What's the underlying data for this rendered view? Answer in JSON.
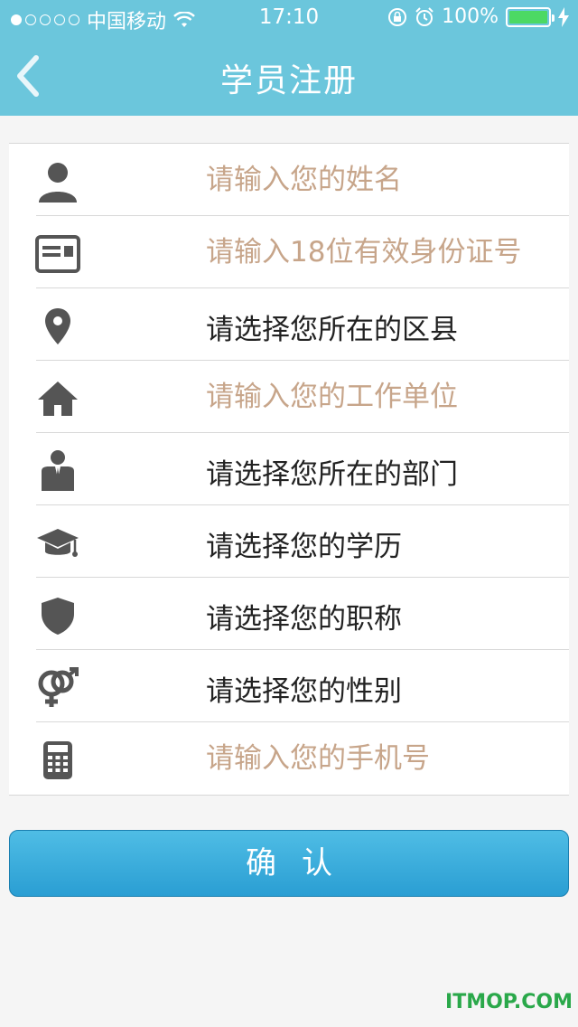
{
  "status_bar": {
    "carrier": "中国移动",
    "time": "17:10",
    "battery": "100%",
    "signal_dots_filled": 1
  },
  "nav": {
    "title": "学员注册",
    "back_icon": "chevron-left-icon"
  },
  "form": {
    "name_placeholder": "请输入您的姓名",
    "id_placeholder": "请输入18位有效身份证号",
    "district_label": "请选择您所在的区县",
    "workplace_placeholder": "请输入您的工作单位",
    "department_label": "请选择您所在的部门",
    "education_label": "请选择您的学历",
    "title_label": "请选择您的职称",
    "gender_label": "请选择您的性别",
    "phone_placeholder": "请输入您的手机号"
  },
  "confirm_label": "确认",
  "watermark": "ITMOP.COM",
  "colors": {
    "header": "#6bc6dc",
    "placeholder": "#c7a58a",
    "button": "#2a9ed3",
    "icon": "#555555"
  }
}
